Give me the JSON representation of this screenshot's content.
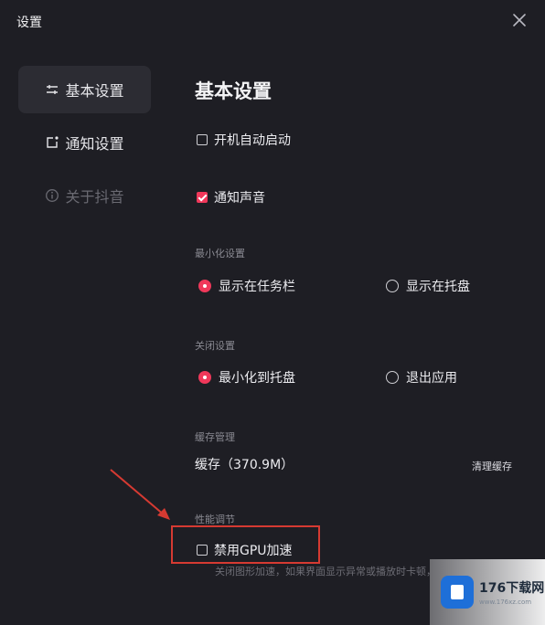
{
  "window": {
    "title": "设置"
  },
  "sidebar": {
    "items": [
      {
        "label": "基本设置",
        "icon": "sliders-icon",
        "state": "active"
      },
      {
        "label": "通知设置",
        "icon": "notification-icon",
        "state": "normal"
      },
      {
        "label": "关于抖音",
        "icon": "info-icon",
        "state": "disabled"
      }
    ]
  },
  "main": {
    "title": "基本设置",
    "autostart": {
      "label": "开机自动启动",
      "checked": false
    },
    "notify_sound": {
      "label": "通知声音",
      "checked": true
    },
    "minimize_section": {
      "label": "最小化设置",
      "options": [
        {
          "label": "显示在任务栏",
          "selected": true
        },
        {
          "label": "显示在托盘",
          "selected": false
        }
      ]
    },
    "close_section": {
      "label": "关闭设置",
      "options": [
        {
          "label": "最小化到托盘",
          "selected": true
        },
        {
          "label": "退出应用",
          "selected": false
        }
      ]
    },
    "cache_section": {
      "label": "缓存管理",
      "cache_text": "缓存（370.9M）",
      "clear_button": "清理缓存"
    },
    "performance_section": {
      "label": "性能调节",
      "gpu": {
        "label": "禁用GPU加速",
        "checked": false
      },
      "hint": "关闭图形加速，如果界面显示异常或播放时卡顿，"
    }
  },
  "colors": {
    "accent": "#f0385a",
    "background": "#1e1e24",
    "annotation": "#d63a32"
  },
  "watermark": {
    "title": "176下载网",
    "subtitle": "www.176xz.com"
  }
}
